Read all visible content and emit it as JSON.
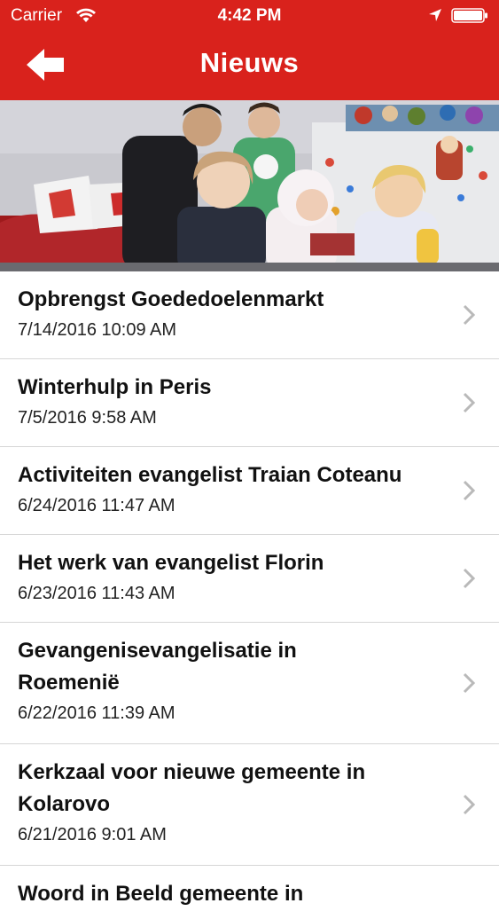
{
  "status_bar": {
    "carrier": "Carrier",
    "time": "4:42 PM",
    "icons": [
      "wifi-icon",
      "location-arrow-icon",
      "battery-icon"
    ]
  },
  "nav": {
    "title": "Nieuws",
    "back_icon": "back-arrow-icon",
    "color": "#d9221c"
  },
  "hero": {
    "image": "family-photo"
  },
  "news": [
    {
      "title": "Opbrengst Goededoelenmarkt",
      "date": "7/14/2016 10:09 AM"
    },
    {
      "title": "Winterhulp in Peris",
      "date": "7/5/2016 9:58 AM"
    },
    {
      "title": "Activiteiten evangelist Traian Coteanu",
      "date": "6/24/2016 11:47 AM"
    },
    {
      "title": "Het werk van evangelist Florin",
      "date": "6/23/2016 11:43 AM"
    },
    {
      "title": "Gevangenisevangelisatie in Roemenië",
      "date": "6/22/2016 11:39 AM"
    },
    {
      "title": "Kerkzaal voor nieuwe gemeente in Kolarovo",
      "date": "6/21/2016 9:01 AM"
    },
    {
      "title": "Woord in Beeld gemeente in",
      "date": ""
    }
  ]
}
